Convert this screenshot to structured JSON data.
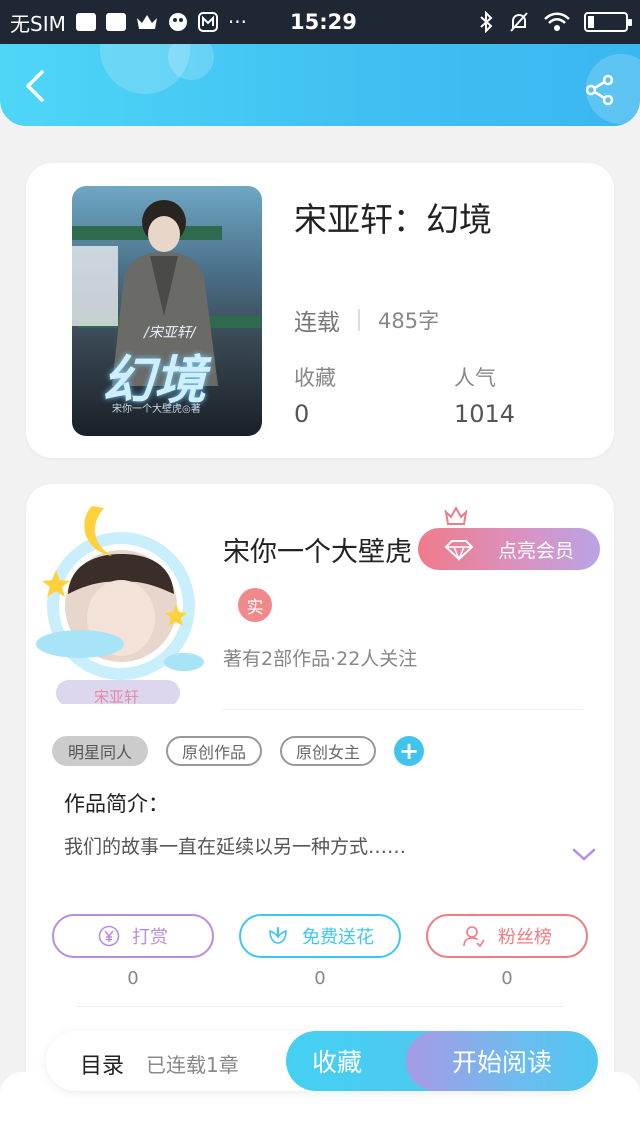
{
  "status_bar": {
    "carrier": "无SIM",
    "time": "15:29",
    "dots": "···"
  },
  "header": {
    "back_icon": "chevron-left-icon",
    "share_icon": "share-icon"
  },
  "book": {
    "title": "宋亚轩：幻境",
    "status": "连载",
    "word_count": "485字",
    "favorites_label": "收藏",
    "favorites_value": "0",
    "popularity_label": "人气",
    "popularity_value": "1014",
    "cover": {
      "top_text": "/宋亚轩/",
      "main_text": "幻境",
      "author_line": "宋你一个大壁虎◎著"
    }
  },
  "author": {
    "name": "宋你一个大壁虎",
    "vip_label": "点亮会员",
    "real_badge": "实",
    "info": "著有2部作品·22人关注",
    "avatar_tag": "宋亚轩"
  },
  "tags": [
    {
      "label": "明星同人",
      "filled": true
    },
    {
      "label": "原创作品",
      "filled": false
    },
    {
      "label": "原创女主",
      "filled": false
    }
  ],
  "intro": {
    "title": "作品简介：",
    "text": "我们的故事一直在延续以另一种方式……"
  },
  "actions": [
    {
      "label": "打赏",
      "icon": "yen-icon",
      "count": "0",
      "color": "#b98ee0"
    },
    {
      "label": "免费送花",
      "icon": "flower-icon",
      "count": "0",
      "color": "#40c8ec"
    },
    {
      "label": "粉丝榜",
      "icon": "person-icon",
      "count": "0",
      "color": "#f07b80"
    }
  ],
  "bottom": {
    "toc_label": "目录",
    "chapters_label": "已连载1章",
    "favorite_label": "收藏",
    "read_label": "开始阅读"
  }
}
